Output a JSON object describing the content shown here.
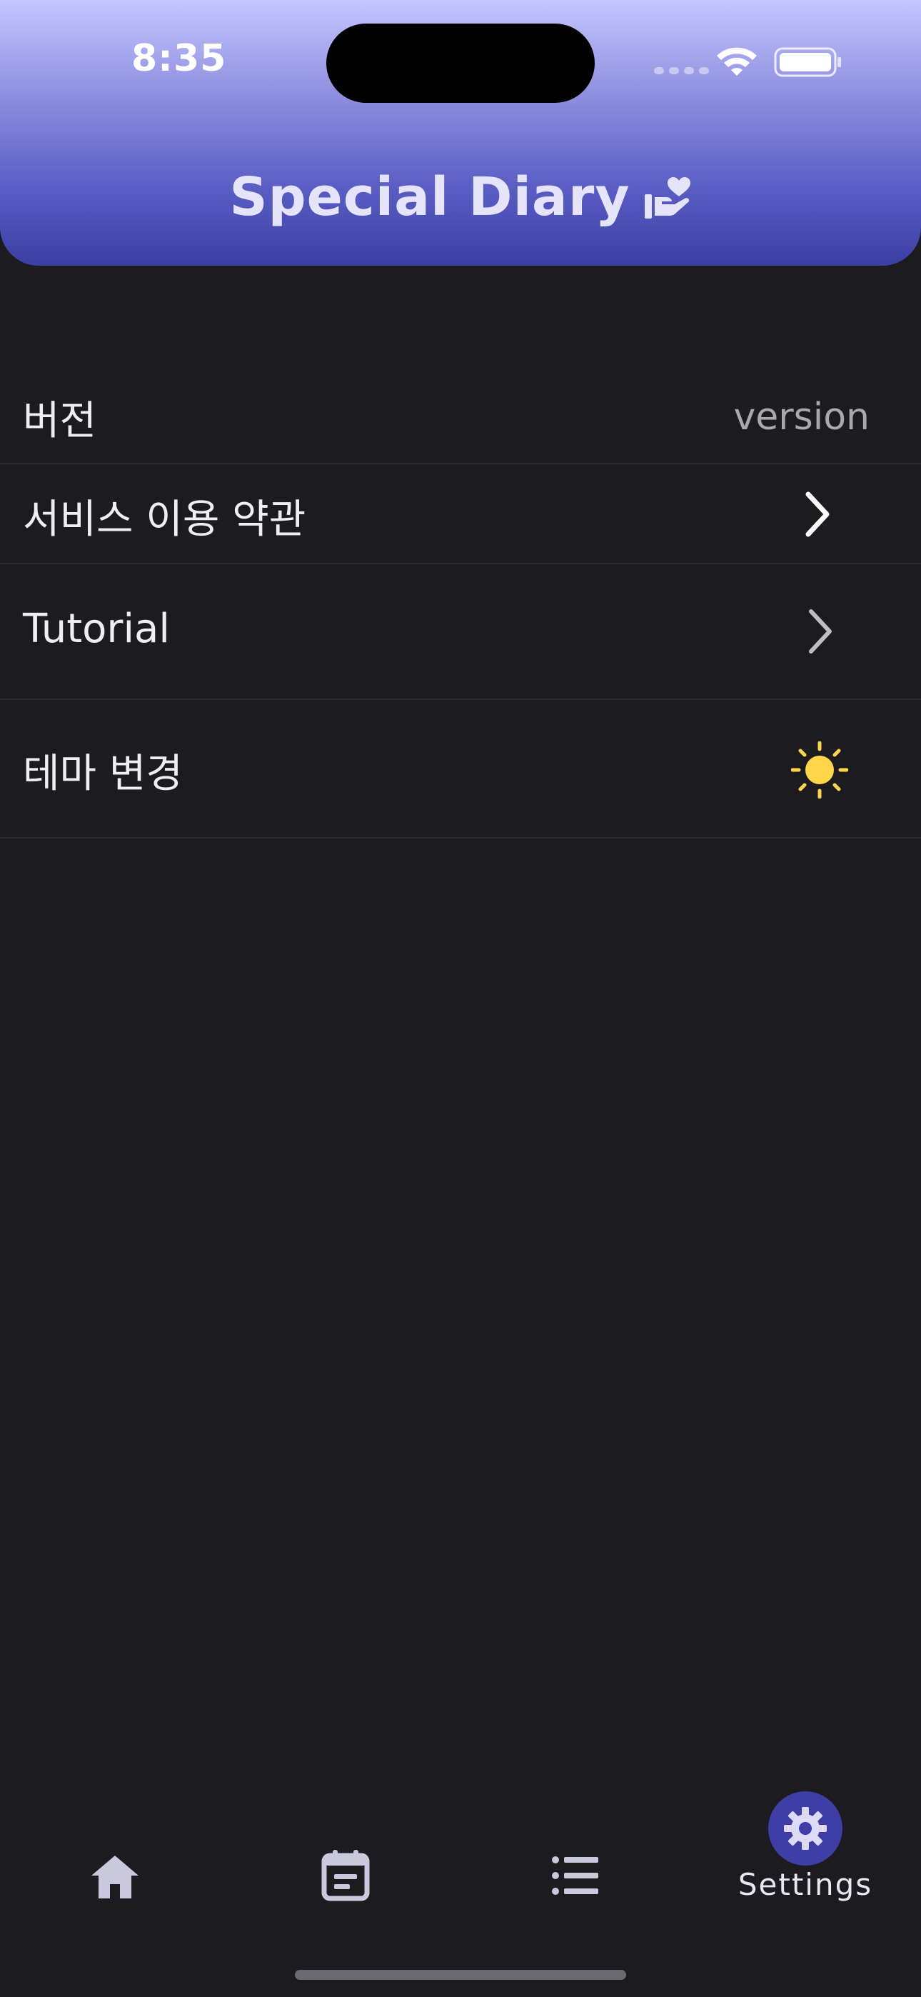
{
  "status_bar": {
    "time": "8:35"
  },
  "header": {
    "title": "Special Diary",
    "title_icon": "hand-heart-icon"
  },
  "settings": {
    "version": {
      "label": "버전",
      "value": "version"
    },
    "terms": {
      "label": "서비스 이용 약관",
      "icon": "chevron-right-icon"
    },
    "tutorial": {
      "label": "Tutorial",
      "icon": "chevron-right-icon"
    },
    "theme": {
      "label": "테마 변경",
      "icon": "sun-icon"
    }
  },
  "bottom_nav": {
    "items": [
      {
        "icon": "home-icon",
        "label": ""
      },
      {
        "icon": "calendar-icon",
        "label": ""
      },
      {
        "icon": "list-icon",
        "label": ""
      },
      {
        "icon": "gear-icon",
        "label": "Settings",
        "selected": true
      }
    ]
  },
  "colors": {
    "background": "#1c1b20",
    "header_top": "#c5c6ff",
    "header_bottom": "#3b3fa4",
    "accent": "#3d3fa6",
    "sun": "#ffd54a"
  }
}
